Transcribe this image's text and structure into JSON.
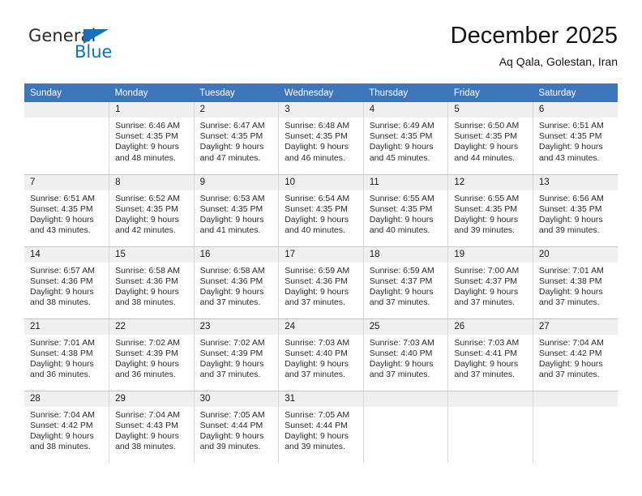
{
  "brand": {
    "name_part1": "General",
    "name_part2": "Blue",
    "accent_color": "#1270bd",
    "triangle_icon": "triangle-logo-icon"
  },
  "header": {
    "title": "December 2025",
    "subtitle": "Aq Qala, Golestan, Iran"
  },
  "calendar": {
    "header_bg": "#3c76bc",
    "daynum_bg": "#f0f0f0",
    "weekday_labels": [
      "Sunday",
      "Monday",
      "Tuesday",
      "Wednesday",
      "Thursday",
      "Friday",
      "Saturday"
    ],
    "weeks": [
      [
        {
          "day": "",
          "empty": true
        },
        {
          "day": "1",
          "sunrise": "Sunrise: 6:46 AM",
          "sunset": "Sunset: 4:35 PM",
          "daylight_line1": "Daylight: 9 hours",
          "daylight_line2": "and 48 minutes."
        },
        {
          "day": "2",
          "sunrise": "Sunrise: 6:47 AM",
          "sunset": "Sunset: 4:35 PM",
          "daylight_line1": "Daylight: 9 hours",
          "daylight_line2": "and 47 minutes."
        },
        {
          "day": "3",
          "sunrise": "Sunrise: 6:48 AM",
          "sunset": "Sunset: 4:35 PM",
          "daylight_line1": "Daylight: 9 hours",
          "daylight_line2": "and 46 minutes."
        },
        {
          "day": "4",
          "sunrise": "Sunrise: 6:49 AM",
          "sunset": "Sunset: 4:35 PM",
          "daylight_line1": "Daylight: 9 hours",
          "daylight_line2": "and 45 minutes."
        },
        {
          "day": "5",
          "sunrise": "Sunrise: 6:50 AM",
          "sunset": "Sunset: 4:35 PM",
          "daylight_line1": "Daylight: 9 hours",
          "daylight_line2": "and 44 minutes."
        },
        {
          "day": "6",
          "sunrise": "Sunrise: 6:51 AM",
          "sunset": "Sunset: 4:35 PM",
          "daylight_line1": "Daylight: 9 hours",
          "daylight_line2": "and 43 minutes."
        }
      ],
      [
        {
          "day": "7",
          "sunrise": "Sunrise: 6:51 AM",
          "sunset": "Sunset: 4:35 PM",
          "daylight_line1": "Daylight: 9 hours",
          "daylight_line2": "and 43 minutes."
        },
        {
          "day": "8",
          "sunrise": "Sunrise: 6:52 AM",
          "sunset": "Sunset: 4:35 PM",
          "daylight_line1": "Daylight: 9 hours",
          "daylight_line2": "and 42 minutes."
        },
        {
          "day": "9",
          "sunrise": "Sunrise: 6:53 AM",
          "sunset": "Sunset: 4:35 PM",
          "daylight_line1": "Daylight: 9 hours",
          "daylight_line2": "and 41 minutes."
        },
        {
          "day": "10",
          "sunrise": "Sunrise: 6:54 AM",
          "sunset": "Sunset: 4:35 PM",
          "daylight_line1": "Daylight: 9 hours",
          "daylight_line2": "and 40 minutes."
        },
        {
          "day": "11",
          "sunrise": "Sunrise: 6:55 AM",
          "sunset": "Sunset: 4:35 PM",
          "daylight_line1": "Daylight: 9 hours",
          "daylight_line2": "and 40 minutes."
        },
        {
          "day": "12",
          "sunrise": "Sunrise: 6:55 AM",
          "sunset": "Sunset: 4:35 PM",
          "daylight_line1": "Daylight: 9 hours",
          "daylight_line2": "and 39 minutes."
        },
        {
          "day": "13",
          "sunrise": "Sunrise: 6:56 AM",
          "sunset": "Sunset: 4:35 PM",
          "daylight_line1": "Daylight: 9 hours",
          "daylight_line2": "and 39 minutes."
        }
      ],
      [
        {
          "day": "14",
          "sunrise": "Sunrise: 6:57 AM",
          "sunset": "Sunset: 4:36 PM",
          "daylight_line1": "Daylight: 9 hours",
          "daylight_line2": "and 38 minutes."
        },
        {
          "day": "15",
          "sunrise": "Sunrise: 6:58 AM",
          "sunset": "Sunset: 4:36 PM",
          "daylight_line1": "Daylight: 9 hours",
          "daylight_line2": "and 38 minutes."
        },
        {
          "day": "16",
          "sunrise": "Sunrise: 6:58 AM",
          "sunset": "Sunset: 4:36 PM",
          "daylight_line1": "Daylight: 9 hours",
          "daylight_line2": "and 37 minutes."
        },
        {
          "day": "17",
          "sunrise": "Sunrise: 6:59 AM",
          "sunset": "Sunset: 4:36 PM",
          "daylight_line1": "Daylight: 9 hours",
          "daylight_line2": "and 37 minutes."
        },
        {
          "day": "18",
          "sunrise": "Sunrise: 6:59 AM",
          "sunset": "Sunset: 4:37 PM",
          "daylight_line1": "Daylight: 9 hours",
          "daylight_line2": "and 37 minutes."
        },
        {
          "day": "19",
          "sunrise": "Sunrise: 7:00 AM",
          "sunset": "Sunset: 4:37 PM",
          "daylight_line1": "Daylight: 9 hours",
          "daylight_line2": "and 37 minutes."
        },
        {
          "day": "20",
          "sunrise": "Sunrise: 7:01 AM",
          "sunset": "Sunset: 4:38 PM",
          "daylight_line1": "Daylight: 9 hours",
          "daylight_line2": "and 37 minutes."
        }
      ],
      [
        {
          "day": "21",
          "sunrise": "Sunrise: 7:01 AM",
          "sunset": "Sunset: 4:38 PM",
          "daylight_line1": "Daylight: 9 hours",
          "daylight_line2": "and 36 minutes."
        },
        {
          "day": "22",
          "sunrise": "Sunrise: 7:02 AM",
          "sunset": "Sunset: 4:39 PM",
          "daylight_line1": "Daylight: 9 hours",
          "daylight_line2": "and 36 minutes."
        },
        {
          "day": "23",
          "sunrise": "Sunrise: 7:02 AM",
          "sunset": "Sunset: 4:39 PM",
          "daylight_line1": "Daylight: 9 hours",
          "daylight_line2": "and 37 minutes."
        },
        {
          "day": "24",
          "sunrise": "Sunrise: 7:03 AM",
          "sunset": "Sunset: 4:40 PM",
          "daylight_line1": "Daylight: 9 hours",
          "daylight_line2": "and 37 minutes."
        },
        {
          "day": "25",
          "sunrise": "Sunrise: 7:03 AM",
          "sunset": "Sunset: 4:40 PM",
          "daylight_line1": "Daylight: 9 hours",
          "daylight_line2": "and 37 minutes."
        },
        {
          "day": "26",
          "sunrise": "Sunrise: 7:03 AM",
          "sunset": "Sunset: 4:41 PM",
          "daylight_line1": "Daylight: 9 hours",
          "daylight_line2": "and 37 minutes."
        },
        {
          "day": "27",
          "sunrise": "Sunrise: 7:04 AM",
          "sunset": "Sunset: 4:42 PM",
          "daylight_line1": "Daylight: 9 hours",
          "daylight_line2": "and 37 minutes."
        }
      ],
      [
        {
          "day": "28",
          "sunrise": "Sunrise: 7:04 AM",
          "sunset": "Sunset: 4:42 PM",
          "daylight_line1": "Daylight: 9 hours",
          "daylight_line2": "and 38 minutes."
        },
        {
          "day": "29",
          "sunrise": "Sunrise: 7:04 AM",
          "sunset": "Sunset: 4:43 PM",
          "daylight_line1": "Daylight: 9 hours",
          "daylight_line2": "and 38 minutes."
        },
        {
          "day": "30",
          "sunrise": "Sunrise: 7:05 AM",
          "sunset": "Sunset: 4:44 PM",
          "daylight_line1": "Daylight: 9 hours",
          "daylight_line2": "and 39 minutes."
        },
        {
          "day": "31",
          "sunrise": "Sunrise: 7:05 AM",
          "sunset": "Sunset: 4:44 PM",
          "daylight_line1": "Daylight: 9 hours",
          "daylight_line2": "and 39 minutes."
        },
        {
          "day": "",
          "empty": true
        },
        {
          "day": "",
          "empty": true
        },
        {
          "day": "",
          "empty": true
        }
      ]
    ]
  }
}
